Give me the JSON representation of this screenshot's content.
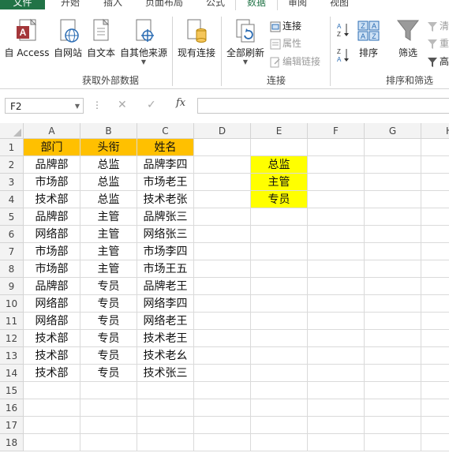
{
  "tabs": {
    "file": "文件",
    "home": "开始",
    "insert": "插入",
    "page_layout": "页面布局",
    "formulas": "公式",
    "data": "数据",
    "review": "审阅",
    "view": "视图"
  },
  "ribbon": {
    "get_external": {
      "access": "自 Access",
      "web": "自网站",
      "text": "自文本",
      "other": "自其他来源",
      "group_label": "获取外部数据"
    },
    "existing": "现有连接",
    "connections": {
      "refresh_all": "全部刷新",
      "connections": "连接",
      "properties": "属性",
      "edit_links": "编辑链接",
      "group_label": "连接"
    },
    "sort_filter": {
      "sort": "排序",
      "filter": "筛选",
      "clear": "清",
      "reapply": "重",
      "advanced": "高",
      "group_label": "排序和筛选"
    }
  },
  "formula_bar": {
    "name_box": "F2",
    "fx": "fx",
    "value": ""
  },
  "grid": {
    "columns": [
      "A",
      "B",
      "C",
      "D",
      "E",
      "F",
      "G",
      "H"
    ],
    "rows": [
      "1",
      "2",
      "3",
      "4",
      "5",
      "6",
      "7",
      "8",
      "9",
      "10",
      "11",
      "12",
      "13",
      "14",
      "15",
      "16",
      "17",
      "18"
    ],
    "table": [
      [
        "部门",
        "头衔",
        "姓名"
      ],
      [
        "品牌部",
        "总监",
        "品牌李四"
      ],
      [
        "市场部",
        "总监",
        "市场老王"
      ],
      [
        "技术部",
        "总监",
        "技术老张"
      ],
      [
        "品牌部",
        "主管",
        "品牌张三"
      ],
      [
        "网络部",
        "主管",
        "网络张三"
      ],
      [
        "市场部",
        "主管",
        "市场李四"
      ],
      [
        "市场部",
        "主管",
        "市场王五"
      ],
      [
        "品牌部",
        "专员",
        "品牌老王"
      ],
      [
        "网络部",
        "专员",
        "网络李四"
      ],
      [
        "网络部",
        "专员",
        "网络老王"
      ],
      [
        "技术部",
        "专员",
        "技术老王"
      ],
      [
        "技术部",
        "专员",
        "技术老幺"
      ],
      [
        "技术部",
        "专员",
        "技术张三"
      ]
    ],
    "e_column": [
      "总监",
      "主管",
      "专员"
    ]
  },
  "colors": {
    "excel_green": "#217346",
    "header_fill": "#ffc000",
    "highlight_fill": "#ffff00"
  }
}
